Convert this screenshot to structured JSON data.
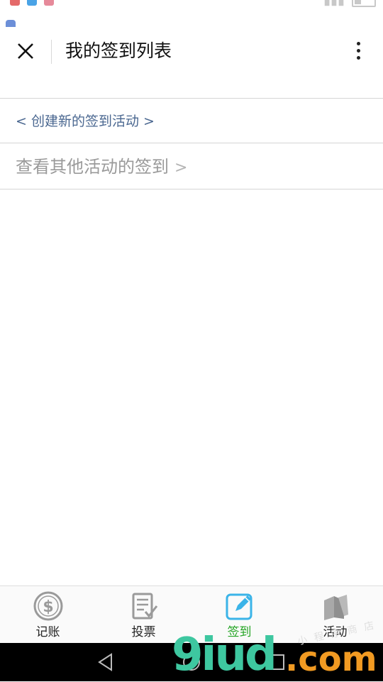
{
  "header": {
    "title": "我的签到列表"
  },
  "links": {
    "create": "< 创建新的签到活动 >",
    "others": "查看其他活动的签到",
    "others_chevron": ">"
  },
  "tabs": [
    {
      "label": "记账",
      "icon": "dollar-coin-icon",
      "active": false
    },
    {
      "label": "投票",
      "icon": "vote-form-icon",
      "active": false
    },
    {
      "label": "签到",
      "icon": "edit-pen-icon",
      "active": true
    },
    {
      "label": "活动",
      "icon": "books-icon",
      "active": false
    }
  ],
  "colors": {
    "active_tab": "#23a423",
    "link_blue": "#4a6790",
    "muted_text": "#9a9a9a",
    "active_icon": "#3bb4e8"
  },
  "watermark": {
    "main": "9iud",
    "dot_com": ".com",
    "cn": "小程序商店"
  }
}
